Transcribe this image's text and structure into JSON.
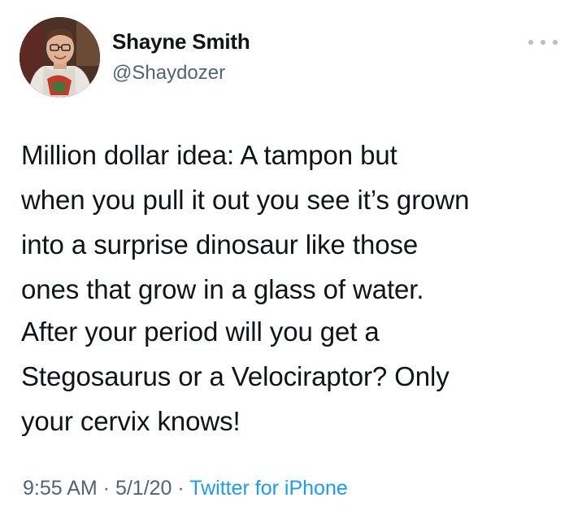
{
  "author": {
    "display_name": "Shayne Smith",
    "handle": "@Shaydozer"
  },
  "menu": {
    "icon": "more-horizontal-icon"
  },
  "tweet": {
    "paragraph1": [
      "Million dollar idea: A tampon but",
      "when you pull it out you see it’s grown",
      "into a surprise dinosaur like those",
      "ones that grow in a glass of water."
    ],
    "paragraph2": [
      "After your period will you get a",
      "Stegosaurus or a Velociraptor? Only",
      "your cervix knows!"
    ]
  },
  "meta": {
    "time": "9:55 AM",
    "separator": " · ",
    "date": "5/1/20",
    "source": "Twitter for iPhone"
  },
  "colors": {
    "text": "#0f1419",
    "secondary": "#536471",
    "link": "#1d9bf0"
  }
}
